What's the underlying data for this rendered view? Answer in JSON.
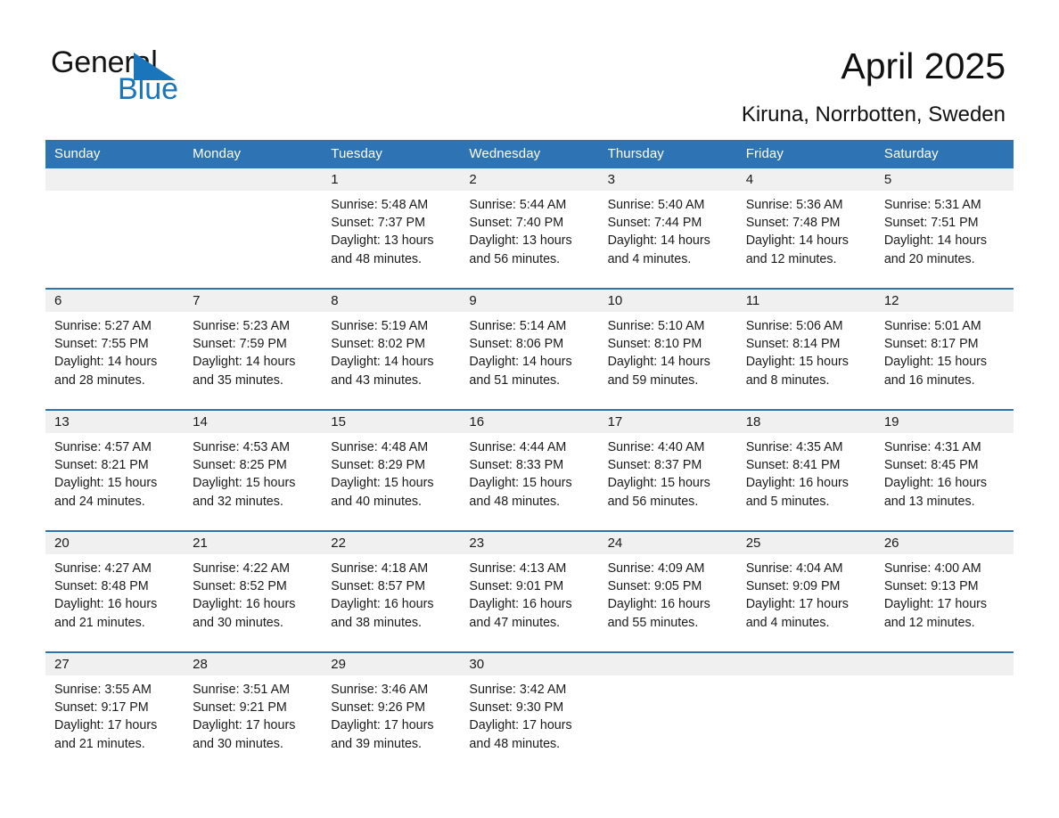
{
  "brand": {
    "word_general": "General",
    "word_blue": "Blue",
    "triangle_color": "#1a75bb",
    "accent_color": "#2e74b5"
  },
  "header": {
    "title": "April 2025",
    "location": "Kiruna, Norrbotten, Sweden"
  },
  "calendar": {
    "weekday_headers": [
      "Sunday",
      "Monday",
      "Tuesday",
      "Wednesday",
      "Thursday",
      "Friday",
      "Saturday"
    ],
    "weeks": [
      [
        {
          "day": "",
          "blank": true,
          "sunrise": "",
          "sunset": "",
          "daylight1": "",
          "daylight2": ""
        },
        {
          "day": "",
          "blank": true,
          "sunrise": "",
          "sunset": "",
          "daylight1": "",
          "daylight2": ""
        },
        {
          "day": "1",
          "blank": false,
          "sunrise": "Sunrise: 5:48 AM",
          "sunset": "Sunset: 7:37 PM",
          "daylight1": "Daylight: 13 hours",
          "daylight2": "and 48 minutes."
        },
        {
          "day": "2",
          "blank": false,
          "sunrise": "Sunrise: 5:44 AM",
          "sunset": "Sunset: 7:40 PM",
          "daylight1": "Daylight: 13 hours",
          "daylight2": "and 56 minutes."
        },
        {
          "day": "3",
          "blank": false,
          "sunrise": "Sunrise: 5:40 AM",
          "sunset": "Sunset: 7:44 PM",
          "daylight1": "Daylight: 14 hours",
          "daylight2": "and 4 minutes."
        },
        {
          "day": "4",
          "blank": false,
          "sunrise": "Sunrise: 5:36 AM",
          "sunset": "Sunset: 7:48 PM",
          "daylight1": "Daylight: 14 hours",
          "daylight2": "and 12 minutes."
        },
        {
          "day": "5",
          "blank": false,
          "sunrise": "Sunrise: 5:31 AM",
          "sunset": "Sunset: 7:51 PM",
          "daylight1": "Daylight: 14 hours",
          "daylight2": "and 20 minutes."
        }
      ],
      [
        {
          "day": "6",
          "blank": false,
          "sunrise": "Sunrise: 5:27 AM",
          "sunset": "Sunset: 7:55 PM",
          "daylight1": "Daylight: 14 hours",
          "daylight2": "and 28 minutes."
        },
        {
          "day": "7",
          "blank": false,
          "sunrise": "Sunrise: 5:23 AM",
          "sunset": "Sunset: 7:59 PM",
          "daylight1": "Daylight: 14 hours",
          "daylight2": "and 35 minutes."
        },
        {
          "day": "8",
          "blank": false,
          "sunrise": "Sunrise: 5:19 AM",
          "sunset": "Sunset: 8:02 PM",
          "daylight1": "Daylight: 14 hours",
          "daylight2": "and 43 minutes."
        },
        {
          "day": "9",
          "blank": false,
          "sunrise": "Sunrise: 5:14 AM",
          "sunset": "Sunset: 8:06 PM",
          "daylight1": "Daylight: 14 hours",
          "daylight2": "and 51 minutes."
        },
        {
          "day": "10",
          "blank": false,
          "sunrise": "Sunrise: 5:10 AM",
          "sunset": "Sunset: 8:10 PM",
          "daylight1": "Daylight: 14 hours",
          "daylight2": "and 59 minutes."
        },
        {
          "day": "11",
          "blank": false,
          "sunrise": "Sunrise: 5:06 AM",
          "sunset": "Sunset: 8:14 PM",
          "daylight1": "Daylight: 15 hours",
          "daylight2": "and 8 minutes."
        },
        {
          "day": "12",
          "blank": false,
          "sunrise": "Sunrise: 5:01 AM",
          "sunset": "Sunset: 8:17 PM",
          "daylight1": "Daylight: 15 hours",
          "daylight2": "and 16 minutes."
        }
      ],
      [
        {
          "day": "13",
          "blank": false,
          "sunrise": "Sunrise: 4:57 AM",
          "sunset": "Sunset: 8:21 PM",
          "daylight1": "Daylight: 15 hours",
          "daylight2": "and 24 minutes."
        },
        {
          "day": "14",
          "blank": false,
          "sunrise": "Sunrise: 4:53 AM",
          "sunset": "Sunset: 8:25 PM",
          "daylight1": "Daylight: 15 hours",
          "daylight2": "and 32 minutes."
        },
        {
          "day": "15",
          "blank": false,
          "sunrise": "Sunrise: 4:48 AM",
          "sunset": "Sunset: 8:29 PM",
          "daylight1": "Daylight: 15 hours",
          "daylight2": "and 40 minutes."
        },
        {
          "day": "16",
          "blank": false,
          "sunrise": "Sunrise: 4:44 AM",
          "sunset": "Sunset: 8:33 PM",
          "daylight1": "Daylight: 15 hours",
          "daylight2": "and 48 minutes."
        },
        {
          "day": "17",
          "blank": false,
          "sunrise": "Sunrise: 4:40 AM",
          "sunset": "Sunset: 8:37 PM",
          "daylight1": "Daylight: 15 hours",
          "daylight2": "and 56 minutes."
        },
        {
          "day": "18",
          "blank": false,
          "sunrise": "Sunrise: 4:35 AM",
          "sunset": "Sunset: 8:41 PM",
          "daylight1": "Daylight: 16 hours",
          "daylight2": "and 5 minutes."
        },
        {
          "day": "19",
          "blank": false,
          "sunrise": "Sunrise: 4:31 AM",
          "sunset": "Sunset: 8:45 PM",
          "daylight1": "Daylight: 16 hours",
          "daylight2": "and 13 minutes."
        }
      ],
      [
        {
          "day": "20",
          "blank": false,
          "sunrise": "Sunrise: 4:27 AM",
          "sunset": "Sunset: 8:48 PM",
          "daylight1": "Daylight: 16 hours",
          "daylight2": "and 21 minutes."
        },
        {
          "day": "21",
          "blank": false,
          "sunrise": "Sunrise: 4:22 AM",
          "sunset": "Sunset: 8:52 PM",
          "daylight1": "Daylight: 16 hours",
          "daylight2": "and 30 minutes."
        },
        {
          "day": "22",
          "blank": false,
          "sunrise": "Sunrise: 4:18 AM",
          "sunset": "Sunset: 8:57 PM",
          "daylight1": "Daylight: 16 hours",
          "daylight2": "and 38 minutes."
        },
        {
          "day": "23",
          "blank": false,
          "sunrise": "Sunrise: 4:13 AM",
          "sunset": "Sunset: 9:01 PM",
          "daylight1": "Daylight: 16 hours",
          "daylight2": "and 47 minutes."
        },
        {
          "day": "24",
          "blank": false,
          "sunrise": "Sunrise: 4:09 AM",
          "sunset": "Sunset: 9:05 PM",
          "daylight1": "Daylight: 16 hours",
          "daylight2": "and 55 minutes."
        },
        {
          "day": "25",
          "blank": false,
          "sunrise": "Sunrise: 4:04 AM",
          "sunset": "Sunset: 9:09 PM",
          "daylight1": "Daylight: 17 hours",
          "daylight2": "and 4 minutes."
        },
        {
          "day": "26",
          "blank": false,
          "sunrise": "Sunrise: 4:00 AM",
          "sunset": "Sunset: 9:13 PM",
          "daylight1": "Daylight: 17 hours",
          "daylight2": "and 12 minutes."
        }
      ],
      [
        {
          "day": "27",
          "blank": false,
          "sunrise": "Sunrise: 3:55 AM",
          "sunset": "Sunset: 9:17 PM",
          "daylight1": "Daylight: 17 hours",
          "daylight2": "and 21 minutes."
        },
        {
          "day": "28",
          "blank": false,
          "sunrise": "Sunrise: 3:51 AM",
          "sunset": "Sunset: 9:21 PM",
          "daylight1": "Daylight: 17 hours",
          "daylight2": "and 30 minutes."
        },
        {
          "day": "29",
          "blank": false,
          "sunrise": "Sunrise: 3:46 AM",
          "sunset": "Sunset: 9:26 PM",
          "daylight1": "Daylight: 17 hours",
          "daylight2": "and 39 minutes."
        },
        {
          "day": "30",
          "blank": false,
          "sunrise": "Sunrise: 3:42 AM",
          "sunset": "Sunset: 9:30 PM",
          "daylight1": "Daylight: 17 hours",
          "daylight2": "and 48 minutes."
        },
        {
          "day": "",
          "blank": true,
          "sunrise": "",
          "sunset": "",
          "daylight1": "",
          "daylight2": ""
        },
        {
          "day": "",
          "blank": true,
          "sunrise": "",
          "sunset": "",
          "daylight1": "",
          "daylight2": ""
        },
        {
          "day": "",
          "blank": true,
          "sunrise": "",
          "sunset": "",
          "daylight1": "",
          "daylight2": ""
        }
      ]
    ]
  }
}
